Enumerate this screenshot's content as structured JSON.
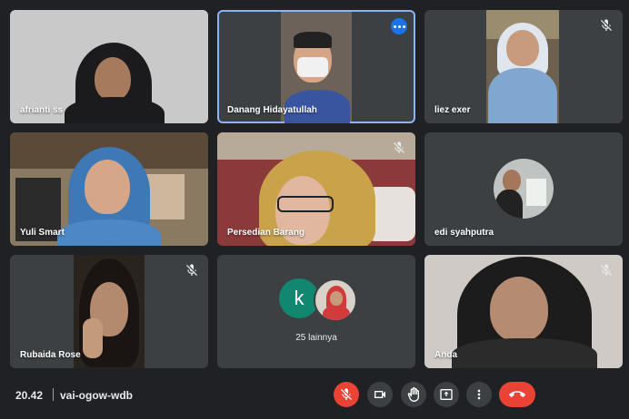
{
  "participants": [
    {
      "name": "afrianti ss"
    },
    {
      "name": "Danang Hidayatullah"
    },
    {
      "name": "liez exer"
    },
    {
      "name": "Yuli Smart"
    },
    {
      "name": "Persedian Barang"
    },
    {
      "name": "edi syahputra"
    },
    {
      "name": "Rubaida Rose"
    },
    {
      "name": "Anda"
    }
  ],
  "overflow": {
    "avatar_letter": "k",
    "label": "25 lainnya"
  },
  "meeting": {
    "time": "20.42",
    "code": "vai-ogow-wdb"
  },
  "icons": {
    "muted": "mic-off-icon",
    "more": "more-options-icon",
    "controls": [
      "mic-off-icon",
      "camera-icon",
      "raise-hand-icon",
      "present-screen-icon",
      "more-vert-icon",
      "end-call-icon"
    ]
  },
  "colors": {
    "background": "#202124",
    "tile": "#3c4043",
    "accent": "#8ab4f8",
    "danger": "#ea4335",
    "avatar_k": "#12876f"
  }
}
